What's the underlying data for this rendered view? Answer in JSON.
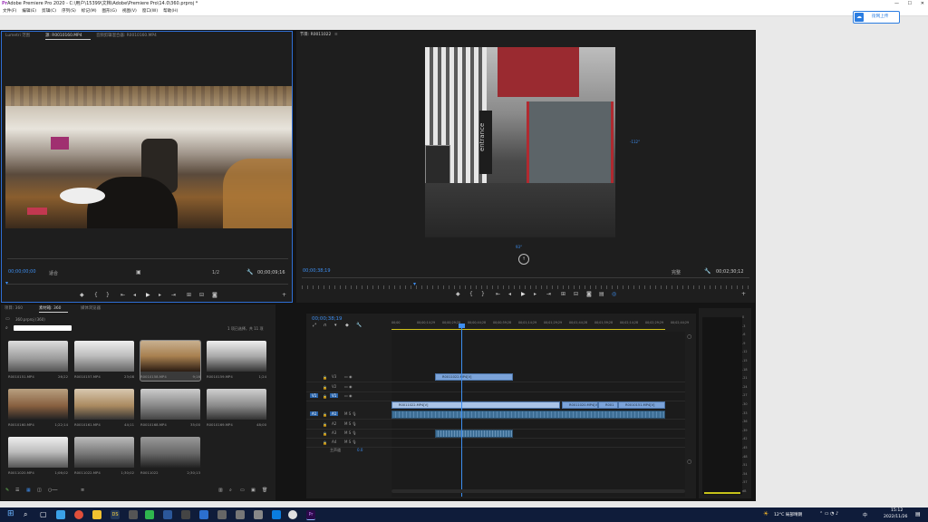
{
  "window": {
    "title": "Adobe Premiere Pro 2020 - C:\\用户\\15399\\文档\\Adobe\\Premiere Pro\\14.0\\360.prproj *"
  },
  "menu": [
    "文件(F)",
    "编辑(E)",
    "剪辑(C)",
    "序列(S)",
    "标记(M)",
    "图形(G)",
    "视图(V)",
    "窗口(W)",
    "帮助(H)"
  ],
  "upload_button": "街网上传",
  "source_monitor": {
    "tabs": [
      "Lumetri 范围",
      "源: R0010160.MP4",
      "音频剪辑混合器: R0010160.MP4"
    ],
    "timecode": "00;00;00;00",
    "fit": "适合",
    "ratio": "1/2",
    "duration": "00;00;09;16"
  },
  "program_monitor": {
    "tab": "节目: R0011022",
    "angle_right": "-112°",
    "angle_bottom": "93°",
    "timecode": "00;00;38;19",
    "fit": "完整",
    "duration": "00;02;30;12",
    "sign_text": "entrance"
  },
  "project_panel": {
    "tabs": [
      "项目: 360",
      "素材箱: 360",
      "媒体浏览器"
    ],
    "project_file": "360.prproj (360)",
    "selection": "1 项已选择，共 11 项",
    "items": [
      {
        "name": "R0010151.MP4",
        "dur": "26;22"
      },
      {
        "name": "R0010157.MP4",
        "dur": "23;08"
      },
      {
        "name": "R0010158.MP4",
        "dur": "9;16"
      },
      {
        "name": "R0010159.MP4",
        "dur": "1;24"
      },
      {
        "name": "R0010160.MP4",
        "dur": "1;22;14"
      },
      {
        "name": "R0010161.MP4",
        "dur": "44;11"
      },
      {
        "name": "R0010168.MP4",
        "dur": "35;00"
      },
      {
        "name": "R0010169.MP4",
        "dur": "48;00"
      },
      {
        "name": "R0011020.MP4",
        "dur": "1;06;02"
      },
      {
        "name": "R0011022.MP4",
        "dur": "1;30;02"
      },
      {
        "name": "R0011022",
        "dur": "2;30;13"
      }
    ]
  },
  "timeline": {
    "timecode": "00;00;38;19",
    "ruler": [
      "00;00",
      "00;00;14;29",
      "00;00;29;29",
      "00;00;44;28",
      "00;00;59;28",
      "00;01;14;29",
      "00;01;29;29",
      "00;01;44;28",
      "00;01;59;28",
      "00;02;14;28",
      "00;02;29;29",
      "00;02;44;29"
    ],
    "tracks": [
      "V3",
      "V2",
      "V1",
      "A1",
      "A2",
      "A3",
      "A4"
    ],
    "master": "主声道",
    "master_val": "0.0",
    "clips_v3": "R0011022.MP4[V]",
    "clips_v1": [
      "R0011022.MP4[V]",
      "R0011020.MP4[V]",
      "R001",
      "R0010151.MP4[V]"
    ]
  },
  "meter": {
    "labels": [
      "0",
      "-3",
      "-6",
      "-9",
      "-12",
      "-15",
      "-18",
      "-21",
      "-24",
      "-27",
      "-30",
      "-33",
      "-36",
      "-39",
      "-42",
      "-45",
      "-48",
      "-51",
      "-54",
      "-57",
      "dB"
    ]
  },
  "taskbar": {
    "weather": "12°C 局部晴朗",
    "time": "15:12",
    "date": "2022/11/26",
    "lang": "中"
  }
}
